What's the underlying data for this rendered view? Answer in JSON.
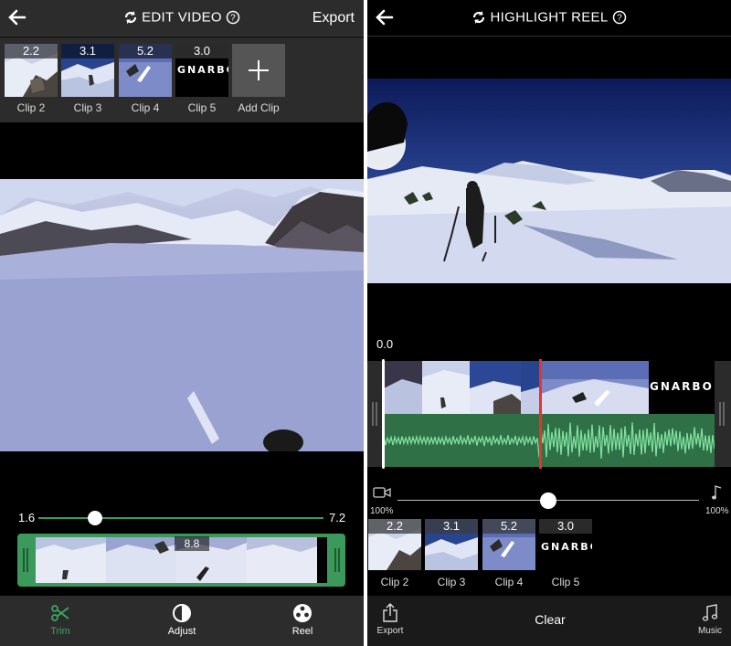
{
  "edit_screen": {
    "title": "EDIT VIDEO",
    "export_label": "Export",
    "clips": [
      {
        "label": "Clip 2",
        "duration": "2.2"
      },
      {
        "label": "Clip 3",
        "duration": "3.1"
      },
      {
        "label": "Clip 4",
        "duration": "5.2"
      },
      {
        "label": "Clip 5",
        "duration": "3.0"
      }
    ],
    "add_clip_label": "Add Clip",
    "gnarbox_text": "GNARBC",
    "trim": {
      "start": "1.6",
      "end": "7.2",
      "duration": "8.8"
    },
    "tabs": [
      {
        "label": "Trim",
        "icon": "scissors-icon"
      },
      {
        "label": "Adjust",
        "icon": "half-circle-icon"
      },
      {
        "label": "Reel",
        "icon": "reel-icon"
      }
    ],
    "accent_color": "#3da65f"
  },
  "reel_screen": {
    "title": "HIGHLIGHT REEL",
    "time_readout": "0.0",
    "gnarbox_text": "GNARBO",
    "mix": {
      "video_pct": "100%",
      "music_pct": "100%",
      "level": 0.5
    },
    "clips": [
      {
        "label": "Clip 2",
        "duration": "2.2"
      },
      {
        "label": "Clip 3",
        "duration": "3.1"
      },
      {
        "label": "Clip 4",
        "duration": "5.2"
      },
      {
        "label": "Clip 5",
        "duration": "3.0"
      }
    ],
    "clip5_text": "GNARBC",
    "export_label": "Export",
    "clear_label": "Clear",
    "music_label": "Music",
    "playhead_color": "#e8322b"
  }
}
